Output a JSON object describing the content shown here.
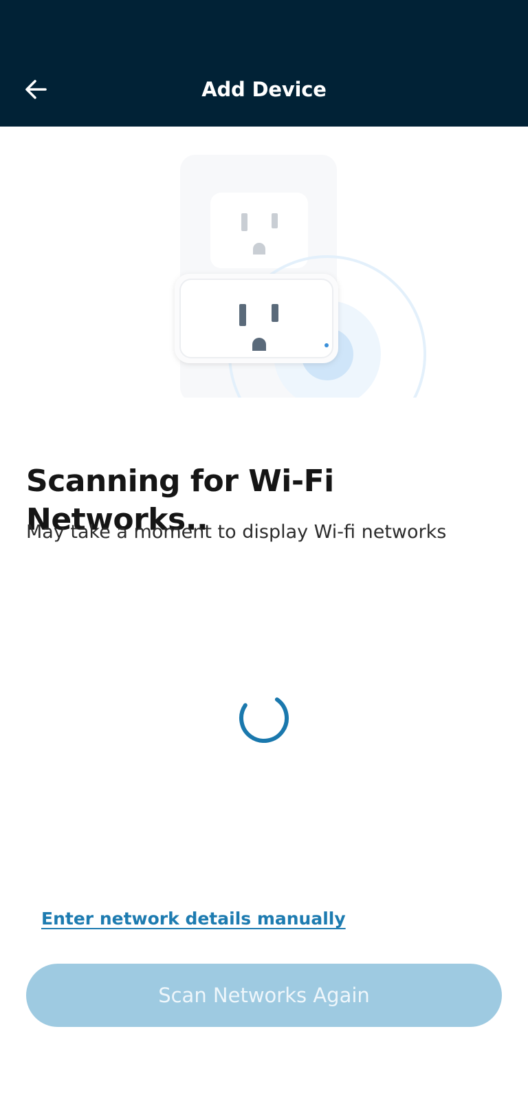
{
  "header": {
    "title": "Add Device",
    "back_icon": "arrow-left-icon",
    "background_color": "#012236"
  },
  "illustration": {
    "description_icon": "smart-plug-illustration"
  },
  "main": {
    "headline": "Scanning for Wi-Fi Networks..",
    "subtext": "May take a moment to display Wi-fi networks",
    "spinner_icon": "loading-spinner-icon",
    "accent_color": "#1d7bb0"
  },
  "actions": {
    "manual_link": "Enter network details manually",
    "scan_button": "Scan Networks Again",
    "scan_button_state": "disabled"
  }
}
